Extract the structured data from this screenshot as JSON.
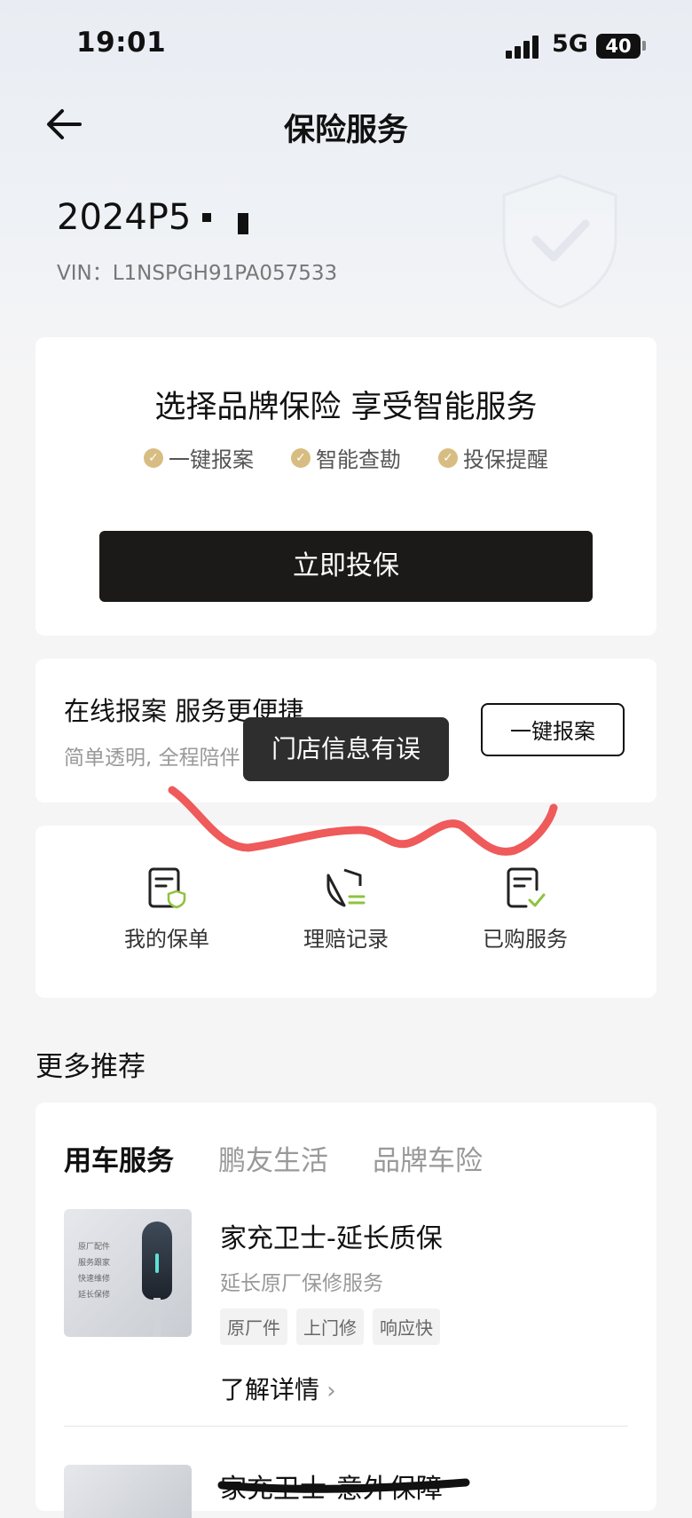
{
  "status": {
    "time": "19:01",
    "network": "5G",
    "battery": "40"
  },
  "nav": {
    "title": "保险服务"
  },
  "vehicle": {
    "model": "2024P5",
    "vin": "VIN：L1NSPGH91PA057533"
  },
  "promo": {
    "title": "选择品牌保险 享受智能服务",
    "features": [
      "一键报案",
      "智能查勘",
      "投保提醒"
    ],
    "cta": "立即投保"
  },
  "report": {
    "title": "在线报案 服务更便捷",
    "subtitle": "简单透明, 全程陪伴",
    "button": "一键报案"
  },
  "toast": "门店信息有误",
  "quick_actions": [
    "我的保单",
    "理赔记录",
    "已购服务"
  ],
  "more": {
    "title": "更多推荐",
    "tabs": [
      "用车服务",
      "鹏友生活",
      "品牌车险"
    ],
    "products": [
      {
        "name": "家充卫士-延长质保",
        "subtitle": "延长原厂保修服务",
        "tags": [
          "原厂件",
          "上门修",
          "响应快"
        ],
        "link": "了解详情",
        "image_labels": [
          "原厂配件",
          "服务跟家",
          "快速维修",
          "延长保修"
        ]
      },
      {
        "name": "家充卫士-意外保障"
      }
    ]
  },
  "colors": {
    "cta": "#1b1a18",
    "gold": "#d8bd82",
    "icon_green": "#8fc23f",
    "scribble": "#ef5a5a"
  }
}
